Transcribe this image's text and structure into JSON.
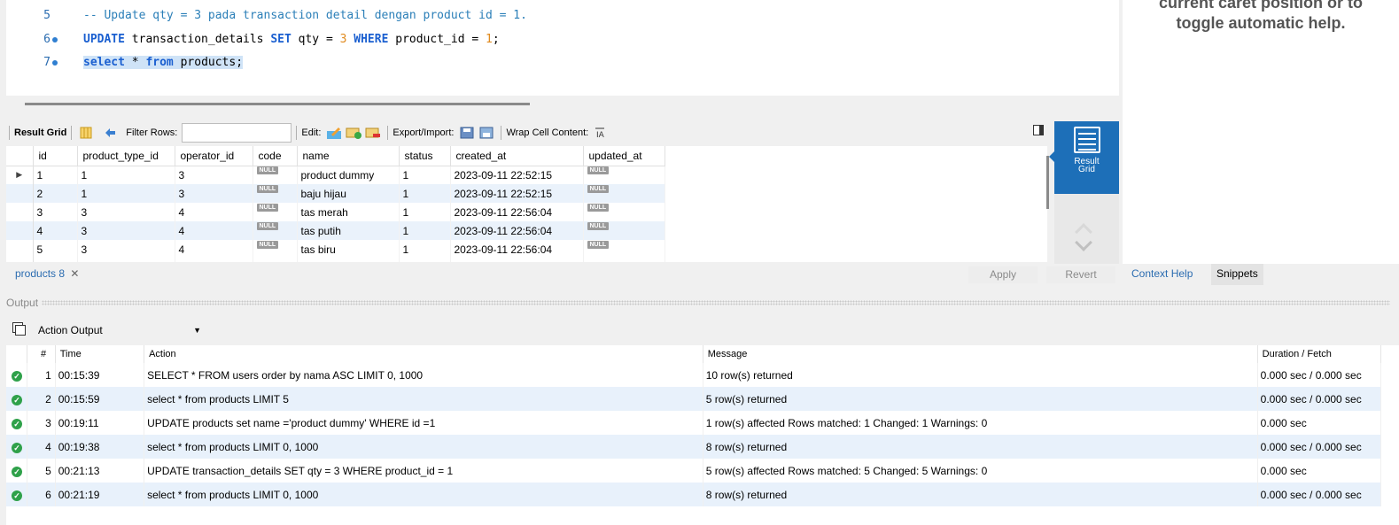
{
  "editor": {
    "lines": [
      {
        "num": "5",
        "parts": [
          {
            "t": "-- Update qty = 3 pada transaction detail dengan product id = 1.",
            "c": "cmt"
          }
        ]
      },
      {
        "num": "6",
        "parts": [
          {
            "t": "UPDATE",
            "c": "kw"
          },
          {
            "t": " transaction_details ",
            "c": ""
          },
          {
            "t": "SET",
            "c": "kw"
          },
          {
            "t": " qty = ",
            "c": ""
          },
          {
            "t": "3",
            "c": "num"
          },
          {
            "t": " ",
            "c": ""
          },
          {
            "t": "WHERE",
            "c": "kw"
          },
          {
            "t": " product_id = ",
            "c": ""
          },
          {
            "t": "1",
            "c": "num"
          },
          {
            "t": ";",
            "c": ""
          }
        ]
      },
      {
        "num": "7",
        "parts": [
          {
            "t": "select",
            "c": "kw sel"
          },
          {
            "t": " * ",
            "c": "sel"
          },
          {
            "t": "from",
            "c": "kw sel"
          },
          {
            "t": " products;",
            "c": "sel"
          }
        ]
      }
    ]
  },
  "help": {
    "text_line1": "current caret position or to",
    "text_line2": "toggle automatic help."
  },
  "toolbar": {
    "result_grid_label": "Result Grid",
    "filter_rows_label": "Filter Rows:",
    "filter_value": "",
    "edit_label": "Edit:",
    "export_label": "Export/Import:",
    "wrap_label": "Wrap Cell Content:"
  },
  "grid": {
    "columns": [
      "id",
      "product_type_id",
      "operator_id",
      "code",
      "name",
      "status",
      "created_at",
      "updated_at"
    ],
    "null_label": "NULL",
    "rows": [
      [
        "1",
        "1",
        "3",
        null,
        "product dummy",
        "1",
        "2023-09-11 22:52:15",
        null
      ],
      [
        "2",
        "1",
        "3",
        null,
        "baju hijau",
        "1",
        "2023-09-11 22:52:15",
        null
      ],
      [
        "3",
        "3",
        "4",
        null,
        "tas merah",
        "1",
        "2023-09-11 22:56:04",
        null
      ],
      [
        "4",
        "3",
        "4",
        null,
        "tas putih",
        "1",
        "2023-09-11 22:56:04",
        null
      ],
      [
        "5",
        "3",
        "4",
        null,
        "tas biru",
        "1",
        "2023-09-11 22:56:04",
        null
      ]
    ]
  },
  "side_panel": {
    "result_grid_line1": "Result",
    "result_grid_line2": "Grid"
  },
  "tabbar": {
    "tab_label": "products 8",
    "apply_label": "Apply",
    "revert_label": "Revert"
  },
  "context_tabs": {
    "context_help": "Context Help",
    "snippets": "Snippets"
  },
  "output": {
    "title": "Output",
    "selector_value": "Action Output",
    "columns": [
      "#",
      "Time",
      "Action",
      "Message",
      "Duration / Fetch"
    ],
    "rows": [
      {
        "n": "1",
        "time": "00:15:39",
        "action": "SELECT * FROM users order by nama ASC LIMIT 0, 1000",
        "message": "10 row(s) returned",
        "duration": "0.000 sec / 0.000 sec"
      },
      {
        "n": "2",
        "time": "00:15:59",
        "action": "select * from products LIMIT 5",
        "message": "5 row(s) returned",
        "duration": "0.000 sec / 0.000 sec"
      },
      {
        "n": "3",
        "time": "00:19:11",
        "action": "UPDATE products set name ='product dummy' WHERE id =1",
        "message": "1 row(s) affected Rows matched: 1  Changed: 1  Warnings: 0",
        "duration": "0.000 sec"
      },
      {
        "n": "4",
        "time": "00:19:38",
        "action": "select * from products LIMIT 0, 1000",
        "message": "8 row(s) returned",
        "duration": "0.000 sec / 0.000 sec"
      },
      {
        "n": "5",
        "time": "00:21:13",
        "action": "UPDATE transaction_details SET qty = 3 WHERE product_id = 1",
        "message": "5 row(s) affected Rows matched: 5  Changed: 5  Warnings: 0",
        "duration": "0.000 sec"
      },
      {
        "n": "6",
        "time": "00:21:19",
        "action": "select * from products LIMIT 0, 1000",
        "message": "8 row(s) returned",
        "duration": "0.000 sec / 0.000 sec"
      }
    ]
  }
}
